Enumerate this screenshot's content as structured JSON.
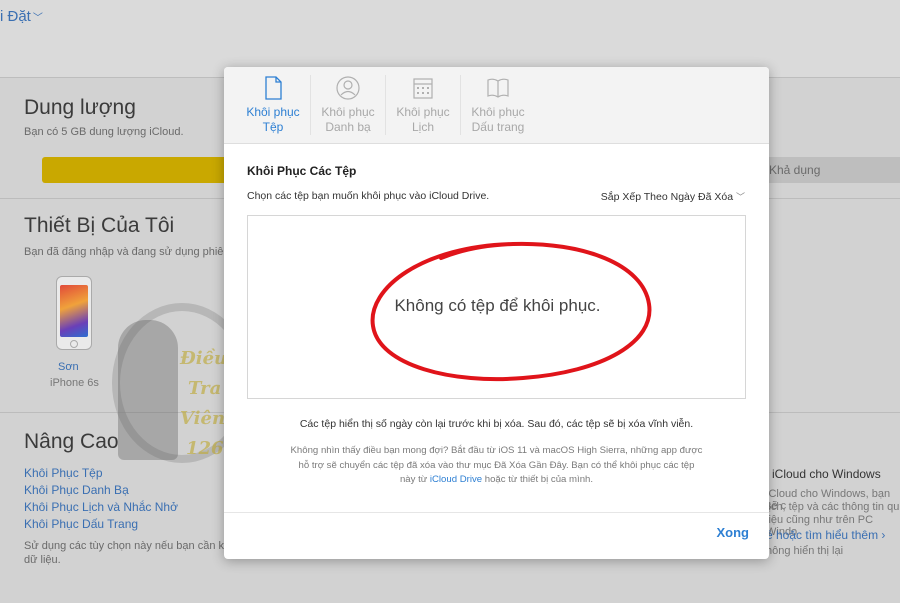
{
  "background": {
    "title": "i Đặt",
    "storage": {
      "heading": "Dung lượng",
      "desc": "Bạn có 5 GB dung lượng iCloud.",
      "available_label": "Khả dụng"
    },
    "devices": {
      "heading": "Thiết Bị Của Tôi",
      "desc": "Bạn đã đăng nhập và đang sử dụng phiê",
      "device_name": "Sơn",
      "device_model": "iPhone 6s"
    },
    "advanced": {
      "heading": "Nâng Cao",
      "links": [
        "Khôi Phục Tệp",
        "Khôi Phục Danh Bạ",
        "Khôi Phục Lịch và Nhắc Nhở",
        "Khôi Phục Dấu Trang"
      ],
      "desc_line1": "Sử dụng các tùy chọn này nếu bạn cần khôi p",
      "desc_line2": "dữ liệu."
    },
    "right_panel": {
      "heading": "iCloud cho Windows",
      "lines": [
        "iCloud cho Windows, bạn sẽ c",
        "lịch, tệp và các thông tin qu",
        "liệu cũng như trên PC Windo"
      ],
      "link": "ề hoặc tìm hiểu thêm ›",
      "footer": "hông hiển thị lại"
    },
    "watermark": [
      "Điều",
      "Tra",
      "Viên",
      "126"
    ]
  },
  "modal": {
    "tabs": [
      {
        "line1": "Khôi phục",
        "line2": "Tệp",
        "icon": "document-icon",
        "active": true
      },
      {
        "line1": "Khôi phục",
        "line2": "Danh bạ",
        "icon": "contact-icon",
        "active": false
      },
      {
        "line1": "Khôi phục",
        "line2": "Lịch",
        "icon": "calendar-icon",
        "active": false
      },
      {
        "line1": "Khôi phục",
        "line2": "Dấu trang",
        "icon": "book-icon",
        "active": false
      }
    ],
    "title": "Khôi Phục Các Tệp",
    "subtitle": "Chọn các tệp bạn muốn khôi phục vào iCloud Drive.",
    "sort_label": "Sắp Xếp Theo Ngày Đã Xóa",
    "empty_message": "Không có tệp để khôi phục.",
    "note_days": "Các tệp hiển thị số ngày còn lại trước khi bị xóa. Sau đó, các tệp sẽ bị xóa vĩnh viễn.",
    "note_help_line1": "Không nhìn thấy điều bạn mong đợi? Bắt đầu từ iOS 11 và macOS High Sierra, những app được",
    "note_help_line2": "hỗ trợ sẽ chuyển các tệp đã xóa vào thư mục Đã Xóa Gần Đây. Bạn có thể khôi phục các tệp",
    "note_help_line3_pre": "này từ ",
    "note_help_link": "iCloud Drive",
    "note_help_line3_post": " hoặc từ thiết bị của mình.",
    "done_label": "Xong"
  },
  "colors": {
    "accent": "#2d7fd3",
    "storage_bar": "#c9a800",
    "annotation": "#e0141a"
  }
}
